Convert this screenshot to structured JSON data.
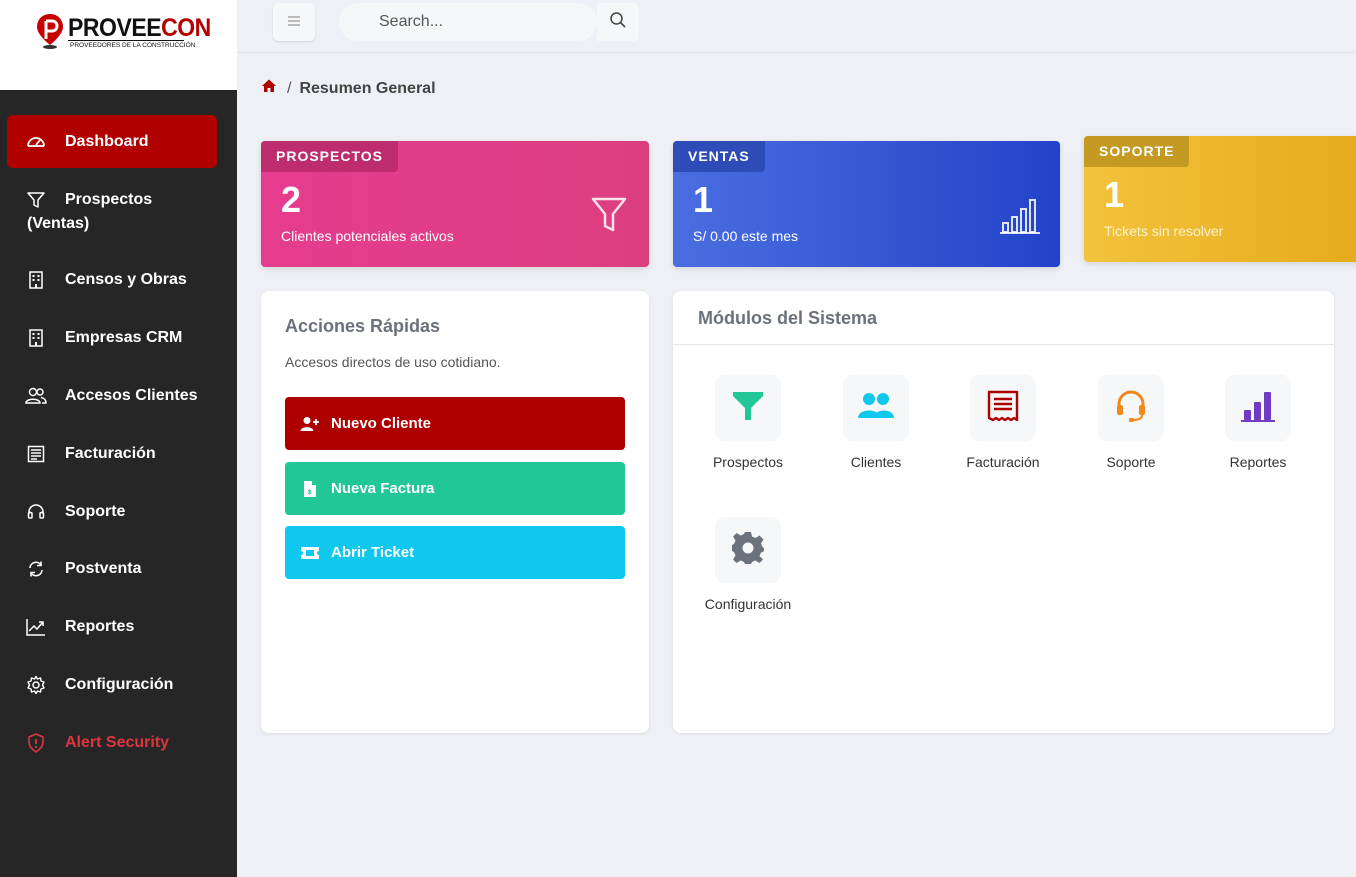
{
  "brand": {
    "title_part1": "PROVEE",
    "title_part2": "CON",
    "subtitle": "PROVEEDORES DE LA CONSTRUCCIÓN"
  },
  "sidebar": {
    "items": [
      {
        "label": "Dashboard",
        "icon": "dashboard-gauge-icon"
      },
      {
        "label": "Prospectos (Ventas)",
        "line1": "Prospectos",
        "line2": "(Ventas)",
        "icon": "funnel-icon"
      },
      {
        "label": "Censos y Obras",
        "icon": "building-icon"
      },
      {
        "label": "Empresas CRM",
        "icon": "building-icon"
      },
      {
        "label": "Accesos Clientes",
        "icon": "users-icon"
      },
      {
        "label": "Facturación",
        "icon": "receipt-icon"
      },
      {
        "label": "Soporte",
        "icon": "headset-icon"
      },
      {
        "label": "Postventa",
        "icon": "refresh-icon"
      },
      {
        "label": "Reportes",
        "icon": "trend-chart-icon"
      },
      {
        "label": "Configuración",
        "icon": "gear-icon"
      },
      {
        "label": "Alert Security",
        "icon": "shield-alert-icon"
      }
    ],
    "active_color": "#b00000",
    "alert_color": "#e0343d"
  },
  "topbar": {
    "menu_icon": "hamburger-icon",
    "search_placeholder": "Search...",
    "search_icon": "search-icon"
  },
  "breadcrumb": {
    "home_icon": "home-icon",
    "separator": "/",
    "current": "Resumen General"
  },
  "stats": {
    "prospectos": {
      "tag": "PROSPECTOS",
      "value": "2",
      "desc": "Clientes potenciales activos",
      "icon": "funnel-icon",
      "color": "#e03c88"
    },
    "ventas": {
      "tag": "VENTAS",
      "value": "1",
      "desc": "S/ 0.00 este mes",
      "icon": "bar-chart-icon",
      "color": "#3558d4"
    },
    "soporte": {
      "tag": "SOPORTE",
      "value": "1",
      "desc": "Tickets sin resolver",
      "color": "#ecb52b"
    }
  },
  "quick": {
    "title": "Acciones Rápidas",
    "subtitle": "Accesos directos de uso cotidiano.",
    "buttons": [
      {
        "label": "Nuevo Cliente",
        "icon": "user-plus-icon",
        "color": "#ae0000"
      },
      {
        "label": "Nueva Factura",
        "icon": "file-invoice-icon",
        "color": "#22c796"
      },
      {
        "label": "Abrir Ticket",
        "icon": "ticket-icon",
        "color": "#10c8ee"
      }
    ]
  },
  "modules": {
    "title": "Módulos del Sistema",
    "items": [
      {
        "label": "Prospectos",
        "icon": "funnel-icon",
        "color": "#22c796"
      },
      {
        "label": "Clientes",
        "icon": "users-icon",
        "color": "#10c8ee"
      },
      {
        "label": "Facturación",
        "icon": "receipt-icon",
        "color": "#ae0000"
      },
      {
        "label": "Soporte",
        "icon": "headset-icon",
        "color": "#f08a1c"
      },
      {
        "label": "Reportes",
        "icon": "bar-chart-icon",
        "color": "#6f3cc4"
      },
      {
        "label": "Configuración",
        "icon": "gear-icon",
        "color": "#6c727d"
      }
    ]
  }
}
